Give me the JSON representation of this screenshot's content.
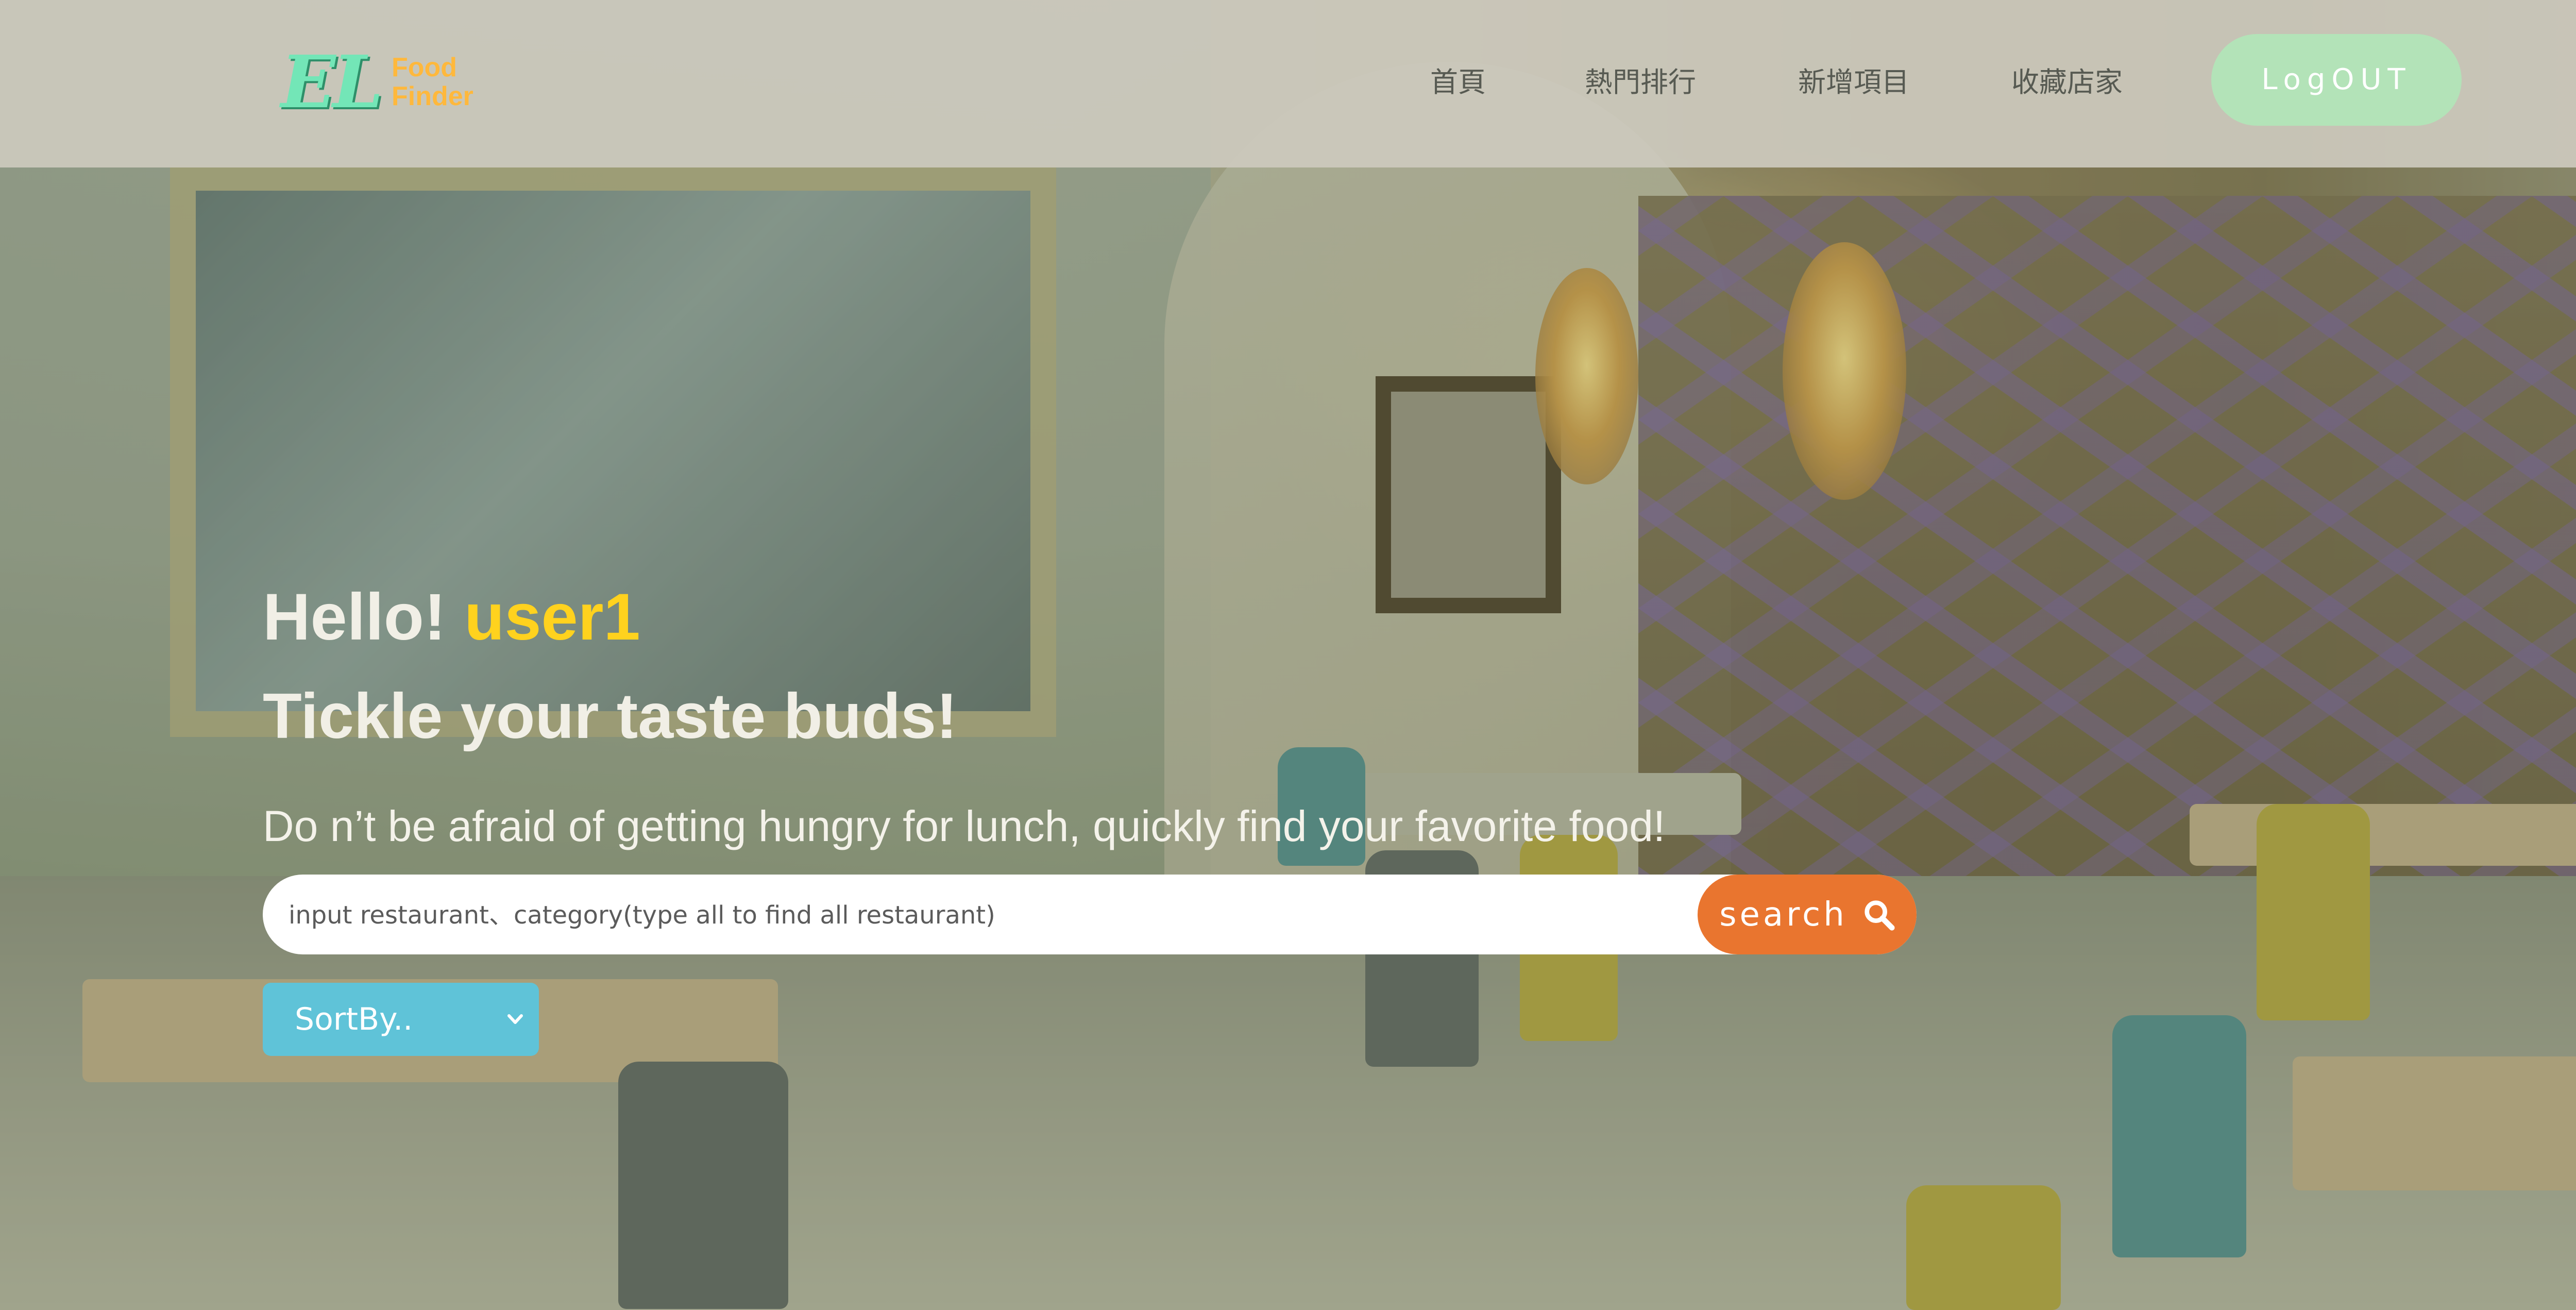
{
  "app": {
    "brand": {
      "mark": "EL",
      "line1": "Food",
      "line2": "Finder"
    }
  },
  "nav": {
    "items": [
      {
        "label": "首頁"
      },
      {
        "label": "熱門排行"
      },
      {
        "label": "新增項目"
      },
      {
        "label": "收藏店家"
      }
    ],
    "logout_label": "LogOUT"
  },
  "hero": {
    "greeting": "Hello!",
    "username": "user1",
    "tagline": "Tickle your taste buds!",
    "subline": "Do n’t be afraid of getting hungry for lunch, quickly find your favorite food!"
  },
  "search": {
    "placeholder": "input restaurant、category(type all to find all restaurant)",
    "value": "",
    "button_label": "search",
    "button_icon": "search-icon"
  },
  "sort": {
    "selected_label": "SortBy..",
    "icon": "chevron-down-icon"
  },
  "colors": {
    "logo_mark": "#73e6b7",
    "logo_text": "#ffb83c",
    "logout_bg": "#b3e3b8",
    "username": "#ffd21e",
    "search_button": "#e9752f",
    "sort_select": "#5fc3d8"
  }
}
